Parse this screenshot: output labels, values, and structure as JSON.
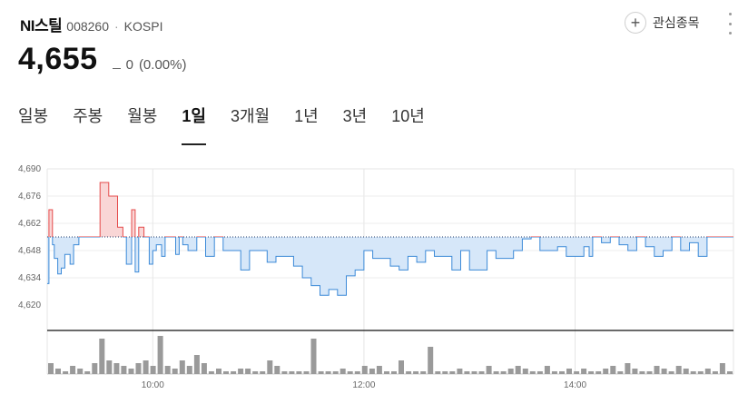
{
  "stock": {
    "name": "NI스틸",
    "code": "008260",
    "separator": "·",
    "market": "KOSPI"
  },
  "watch_label": "관심종목",
  "quote": {
    "price": "4,655",
    "change": "0",
    "change_rate": "(0.00%)"
  },
  "tabs": [
    "일봉",
    "주봉",
    "월봉",
    "1일",
    "3개월",
    "1년",
    "3년",
    "10년"
  ],
  "active_tab": "1일",
  "colors": {
    "up": "#e54b4b",
    "down": "#3c8ad8",
    "up_fill": "#f9d6d6",
    "down_fill": "#d6e7f9",
    "volume": "#9a9a9a",
    "baseline": "#223c6b"
  },
  "chart_data": {
    "type": "area",
    "baseline": 4655,
    "ylim": [
      4620,
      4690
    ],
    "y_ticks": [
      "4,690",
      "4,676",
      "4,662",
      "4,648",
      "4,634",
      "4,620"
    ],
    "x_ticks": [
      "10:00",
      "12:00",
      "14:00"
    ],
    "x_range": [
      "09:00",
      "15:30"
    ],
    "grid": true,
    "series": [
      {
        "x": [
          "09:00",
          "09:01",
          "09:03",
          "09:04",
          "09:06",
          "09:08",
          "09:10",
          "09:13",
          "09:15",
          "09:18",
          "09:21",
          "09:25",
          "09:30",
          "09:35",
          "09:40",
          "09:43",
          "09:45",
          "09:48",
          "09:50",
          "09:52",
          "09:55",
          "09:58",
          "10:00",
          "10:02",
          "10:05",
          "10:07",
          "10:10",
          "10:13",
          "10:15",
          "10:17",
          "10:20",
          "10:25",
          "10:30",
          "10:35",
          "10:40",
          "10:45",
          "10:50",
          "10:55",
          "11:00",
          "11:05",
          "11:10",
          "11:15",
          "11:20",
          "11:25",
          "11:30",
          "11:35",
          "11:40",
          "11:45",
          "11:50",
          "11:55",
          "12:00",
          "12:05",
          "12:10",
          "12:15",
          "12:20",
          "12:25",
          "12:30",
          "12:35",
          "12:40",
          "12:45",
          "12:50",
          "12:55",
          "13:00",
          "13:05",
          "13:10",
          "13:15",
          "13:20",
          "13:25",
          "13:30",
          "13:35",
          "13:40",
          "13:45",
          "13:50",
          "13:55",
          "14:00",
          "14:05",
          "14:08",
          "14:10",
          "14:15",
          "14:20",
          "14:25",
          "14:30",
          "14:35",
          "14:40",
          "14:45",
          "14:50",
          "14:55",
          "15:00",
          "15:05",
          "15:10",
          "15:15",
          "15:20",
          "15:25",
          "15:30"
        ],
        "values": [
          4631,
          4669,
          4651,
          4644,
          4636,
          4639,
          4646,
          4641,
          4651,
          4655,
          4655,
          4655,
          4683,
          4676,
          4660,
          4655,
          4641,
          4669,
          4637,
          4660,
          4655,
          4641,
          4648,
          4651,
          4645,
          4655,
          4655,
          4646,
          4655,
          4651,
          4648,
          4655,
          4645,
          4655,
          4648,
          4648,
          4638,
          4648,
          4648,
          4642,
          4645,
          4645,
          4640,
          4634,
          4630,
          4625,
          4628,
          4625,
          4635,
          4638,
          4648,
          4644,
          4644,
          4640,
          4638,
          4645,
          4642,
          4648,
          4645,
          4645,
          4638,
          4648,
          4638,
          4638,
          4648,
          4644,
          4644,
          4648,
          4654,
          4655,
          4648,
          4648,
          4650,
          4645,
          4645,
          4650,
          4645,
          4655,
          4652,
          4655,
          4651,
          4648,
          4655,
          4650,
          4645,
          4648,
          4655,
          4648,
          4652,
          4645,
          4655,
          4655,
          4655,
          4655
        ]
      }
    ],
    "volume": [
      4,
      2,
      1,
      3,
      2,
      1,
      4,
      13,
      5,
      4,
      3,
      2,
      4,
      5,
      3,
      14,
      3,
      2,
      5,
      3,
      7,
      4,
      1,
      2,
      1,
      1,
      2,
      2,
      1,
      1,
      5,
      3,
      1,
      1,
      1,
      1,
      13,
      1,
      1,
      1,
      2,
      1,
      1,
      3,
      2,
      3,
      1,
      1,
      5,
      1,
      1,
      1,
      10,
      1,
      1,
      1,
      2,
      1,
      1,
      1,
      3,
      1,
      1,
      2,
      3,
      2,
      1,
      1,
      3,
      1,
      1,
      2,
      1,
      2,
      1,
      1,
      2,
      3,
      1,
      4,
      2,
      1,
      1,
      3,
      2,
      1,
      3,
      2,
      1,
      1,
      2,
      1,
      4,
      1
    ]
  }
}
